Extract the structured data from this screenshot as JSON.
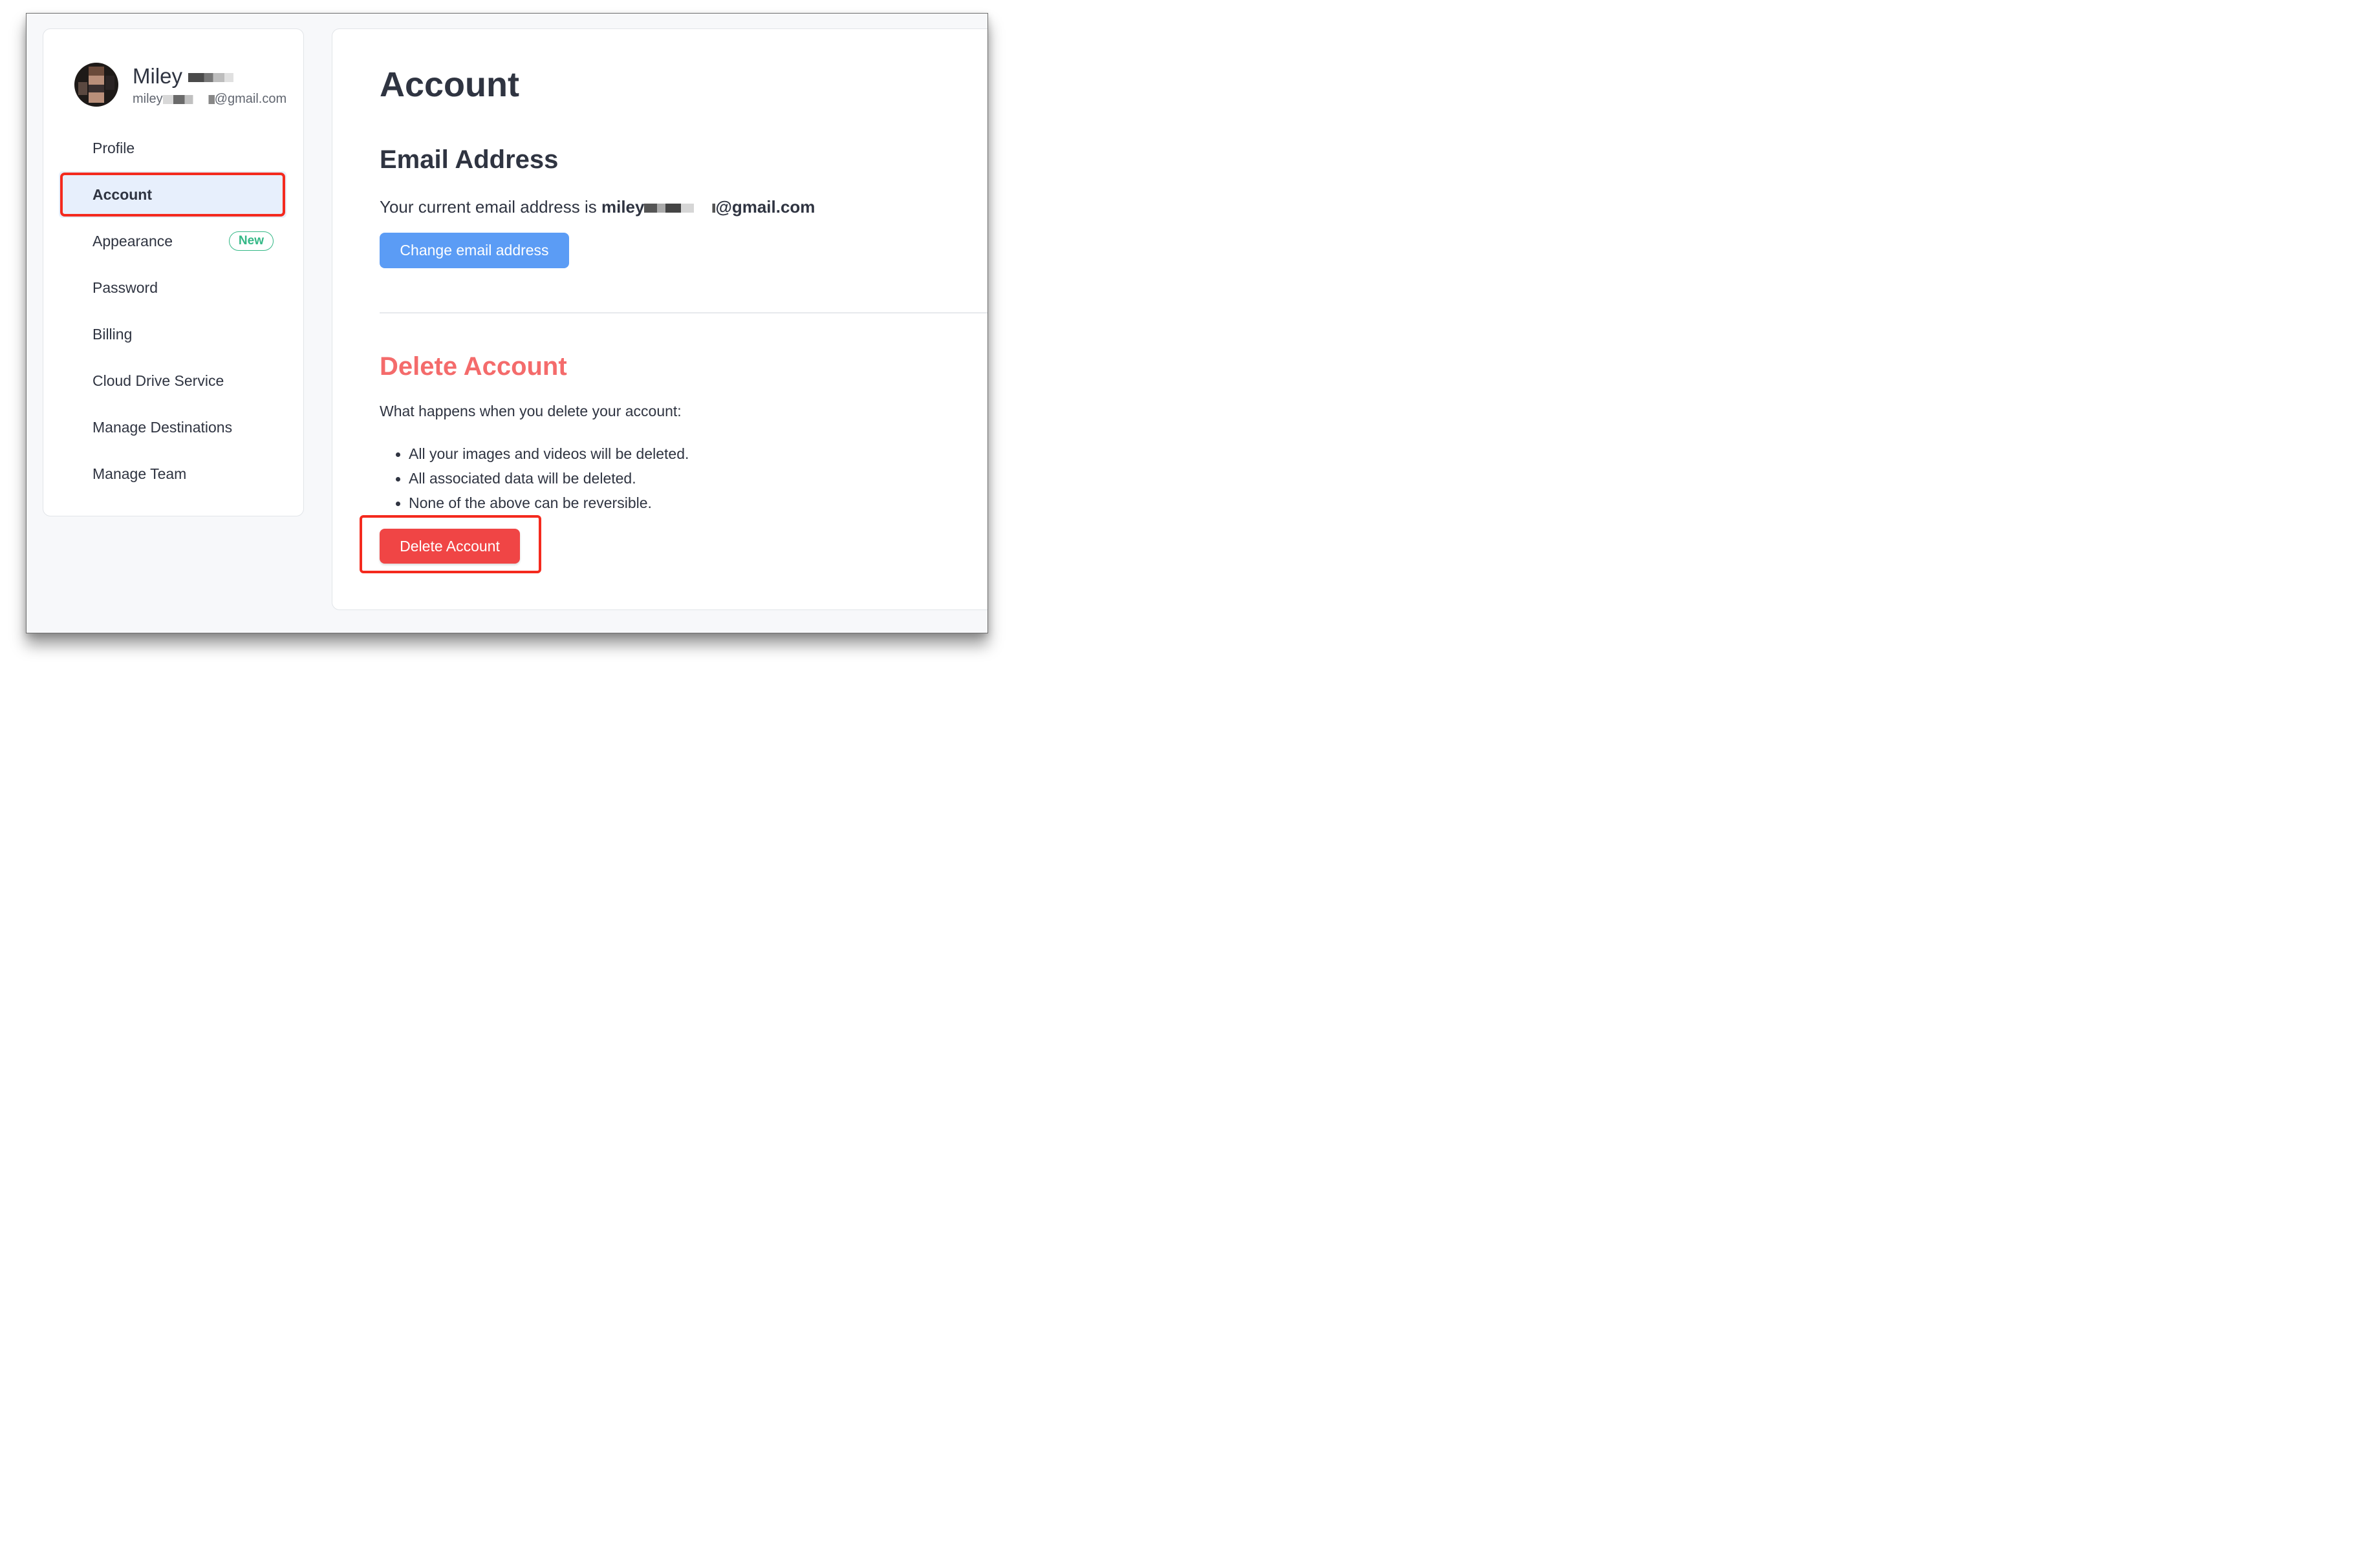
{
  "user": {
    "name": "Miley",
    "email_prefix": "miley",
    "email_suffix": "@gmail.com"
  },
  "sidebar": {
    "items": [
      {
        "label": "Profile",
        "active": false
      },
      {
        "label": "Account",
        "active": true
      },
      {
        "label": "Appearance",
        "active": false,
        "badge": "New"
      },
      {
        "label": "Password",
        "active": false
      },
      {
        "label": "Billing",
        "active": false
      },
      {
        "label": "Cloud Drive Service",
        "active": false
      },
      {
        "label": "Manage Destinations",
        "active": false
      },
      {
        "label": "Manage Team",
        "active": false
      }
    ]
  },
  "main": {
    "title": "Account",
    "email_section": {
      "title": "Email Address",
      "text": "Your current email address is ",
      "email_prefix": "miley",
      "email_suffix": "@gmail.com",
      "button": "Change email address"
    },
    "delete_section": {
      "title": "Delete Account",
      "intro": "What happens when you delete your account:",
      "bullets": [
        "All your images and videos will be deleted.",
        "All associated data will be deleted.",
        "None of the above can be reversible."
      ],
      "button": "Delete Account"
    }
  },
  "colors": {
    "accent_blue": "#5b9cf5",
    "danger_red": "#f04545",
    "delete_title": "#f46b6b",
    "badge_green": "#34b886",
    "highlight_red": "#f42a1e",
    "active_bg": "#e7effc"
  }
}
